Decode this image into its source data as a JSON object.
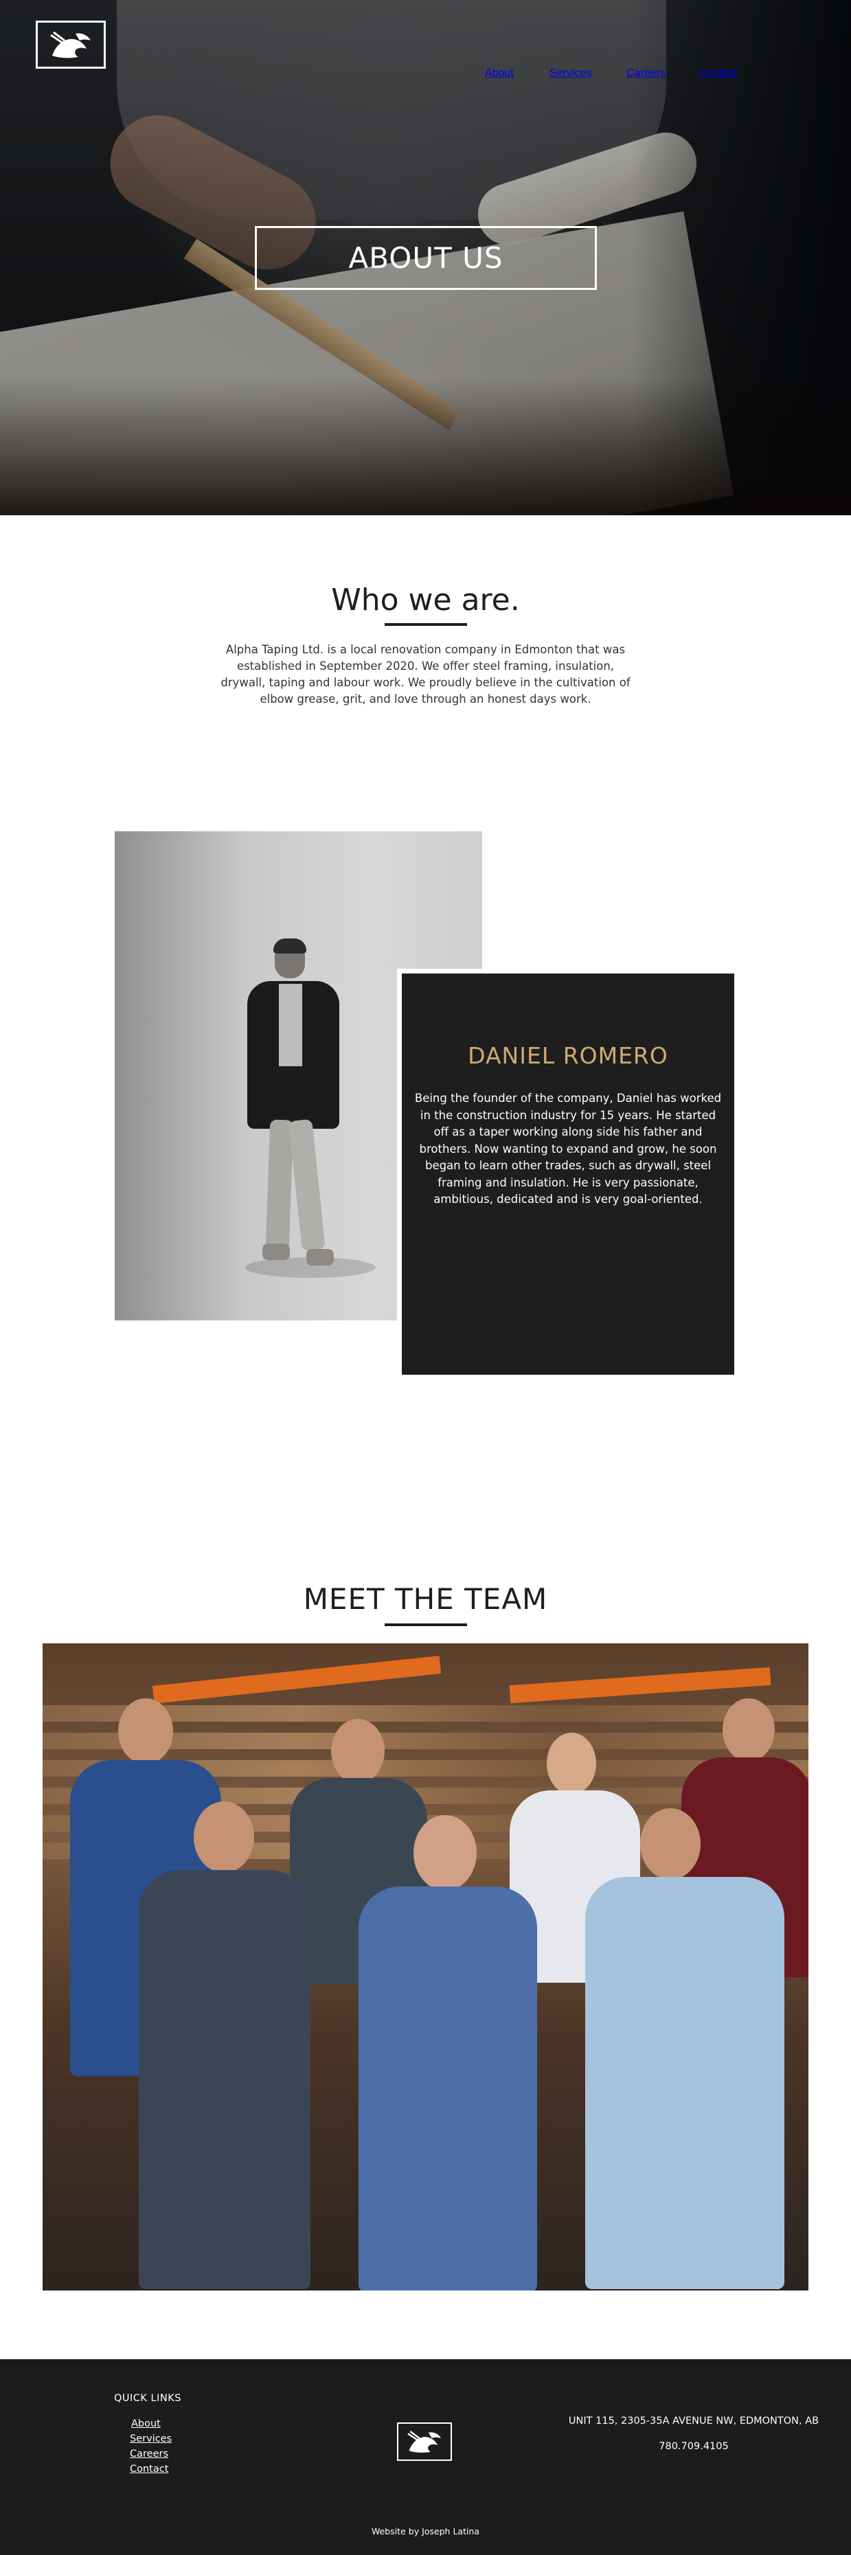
{
  "nav": {
    "items": [
      {
        "label": "About"
      },
      {
        "label": "Services"
      },
      {
        "label": "Careers"
      },
      {
        "label": "Contact"
      }
    ]
  },
  "hero": {
    "title": "ABOUT US"
  },
  "who": {
    "heading": "Who we are.",
    "body": "Alpha Taping Ltd. is a local renovation company in Edmonton that was established in September 2020. We offer steel framing, insulation, drywall, taping and labour work. We proudly believe in the cultivation of elbow grease, grit, and love through an honest days work."
  },
  "profile": {
    "name": "DANIEL ROMERO",
    "bio": "Being the founder of the company, Daniel has worked in the construction industry for 15 years. He started off as a taper working along side his father and brothers. Now wanting to expand and grow, he soon began to learn other trades, such as drywall, steel framing and insulation. He is very passionate, ambitious, dedicated and is very goal-oriented."
  },
  "team": {
    "heading": "MEET THE TEAM"
  },
  "footer": {
    "quick_links_title": "QUICK LINKS",
    "links": [
      {
        "label": "About"
      },
      {
        "label": "Services"
      },
      {
        "label": "Careers"
      },
      {
        "label": "Contact"
      }
    ],
    "address": "UNIT 115, 2305-35A AVENUE NW, EDMONTON, AB",
    "phone": "780.709.4105",
    "credit": "Website by Joseph Latina"
  },
  "colors": {
    "accent_gold": "#d0ab74",
    "card_bg": "#1e1e1e",
    "footer_bg": "#1c1c1c"
  }
}
